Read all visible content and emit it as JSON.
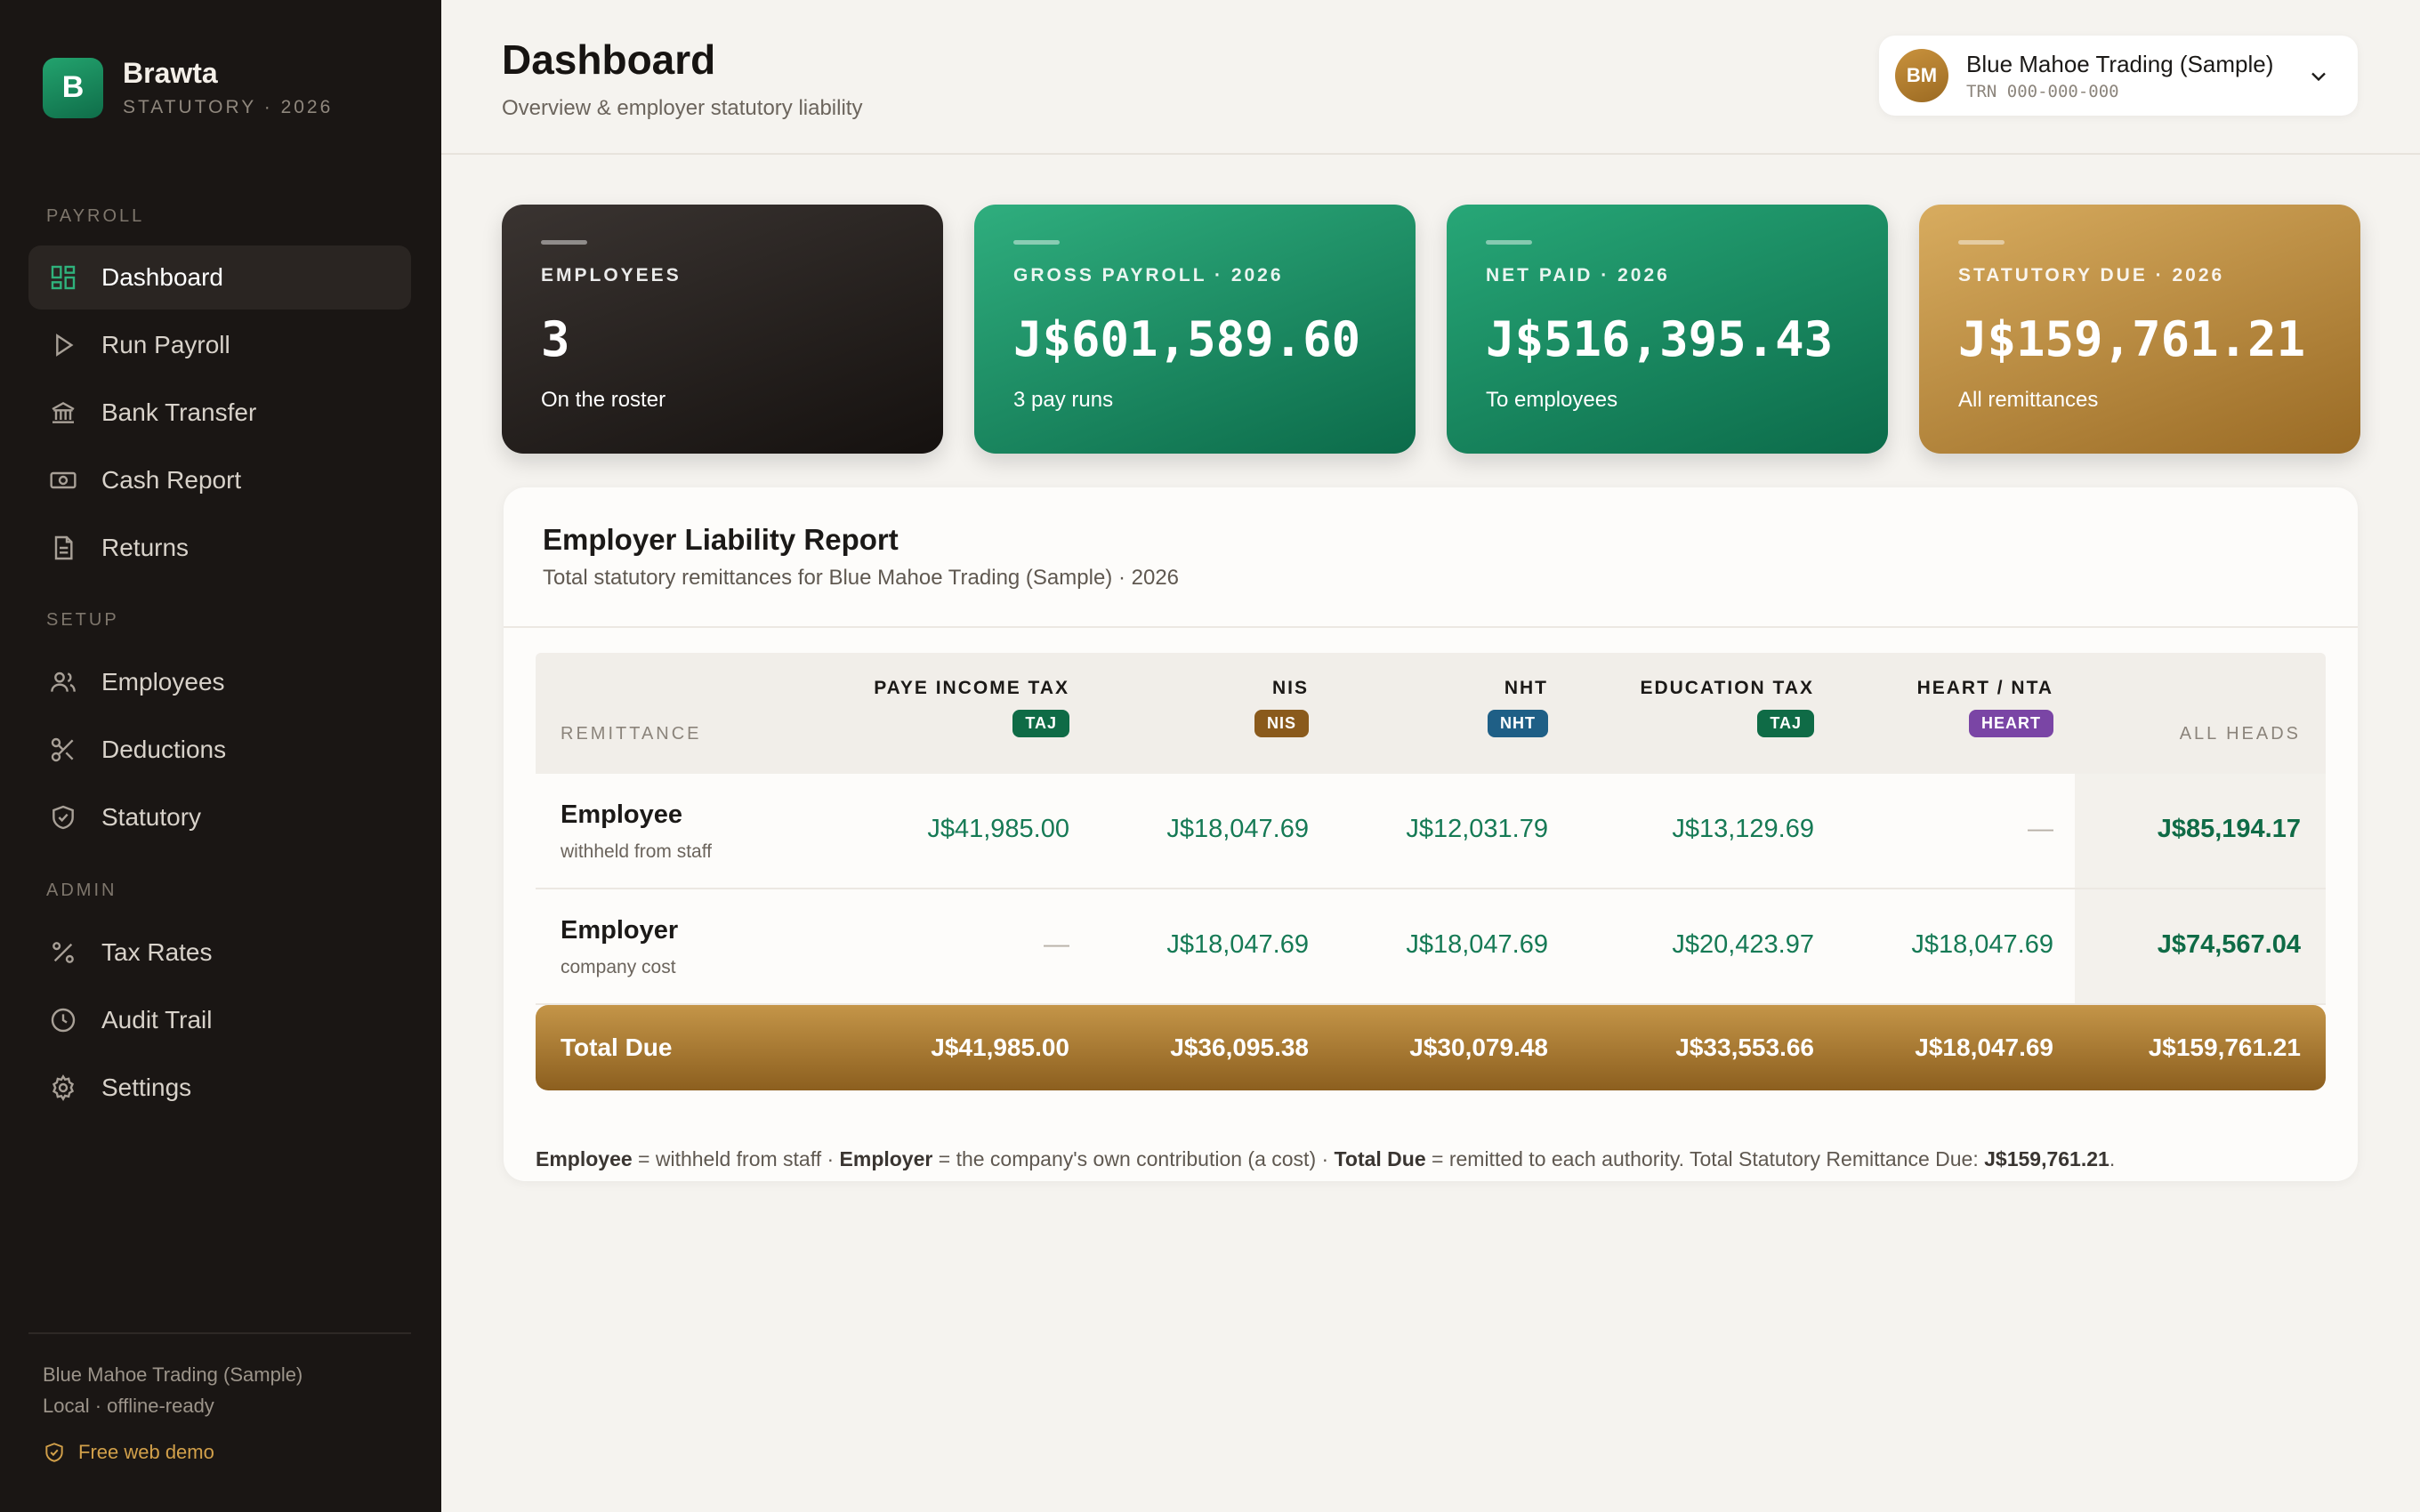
{
  "brand": {
    "logo_letter": "B",
    "name": "Brawta",
    "sub": "STATUTORY · 2026"
  },
  "nav": {
    "sections": {
      "payroll": "PAYROLL",
      "setup": "SETUP",
      "admin": "ADMIN"
    },
    "items": [
      {
        "label": "Dashboard",
        "icon": "grid-icon",
        "active": true
      },
      {
        "label": "Run Payroll",
        "icon": "play-icon"
      },
      {
        "label": "Bank Transfer",
        "icon": "bank-icon"
      },
      {
        "label": "Cash Report",
        "icon": "cash-icon"
      },
      {
        "label": "Returns",
        "icon": "document-icon"
      },
      {
        "label": "Employees",
        "icon": "users-icon"
      },
      {
        "label": "Deductions",
        "icon": "scissors-icon"
      },
      {
        "label": "Statutory",
        "icon": "shield-check-icon"
      },
      {
        "label": "Tax Rates",
        "icon": "percent-icon"
      },
      {
        "label": "Audit Trail",
        "icon": "clock-icon"
      },
      {
        "label": "Settings",
        "icon": "gear-icon"
      }
    ],
    "footer": {
      "org": "Blue Mahoe Trading (Sample)",
      "mode": "Local · offline-ready",
      "demo": "Free web demo"
    }
  },
  "header": {
    "title": "Dashboard",
    "subtitle": "Overview & employer statutory liability",
    "org": {
      "initials": "BM",
      "name": "Blue Mahoe Trading (Sample)",
      "trn": "TRN 000-000-000"
    }
  },
  "cards": [
    {
      "label": "EMPLOYEES",
      "value": "3",
      "sub": "On the roster"
    },
    {
      "label": "GROSS PAYROLL · 2026",
      "value": "J$601,589.60",
      "sub": "3 pay runs"
    },
    {
      "label": "NET PAID · 2026",
      "value": "J$516,395.43",
      "sub": "To employees"
    },
    {
      "label": "STATUTORY DUE · 2026",
      "value": "J$159,761.21",
      "sub": "All remittances"
    }
  ],
  "report": {
    "title": "Employer Liability Report",
    "subtitle": "Total statutory remittances for Blue Mahoe Trading (Sample) · 2026",
    "columns": {
      "remittance": "REMITTANCE",
      "heads": [
        {
          "title": "PAYE INCOME TAX",
          "badge": "TAJ",
          "color": "#0f6b46"
        },
        {
          "title": "NIS",
          "badge": "NIS",
          "color": "#8a5a1c"
        },
        {
          "title": "NHT",
          "badge": "NHT",
          "color": "#1f5f86"
        },
        {
          "title": "EDUCATION TAX",
          "badge": "TAJ",
          "color": "#0f6b46"
        },
        {
          "title": "HEART / NTA",
          "badge": "HEART",
          "color": "#7a45a5"
        }
      ],
      "all": "ALL HEADS"
    },
    "rows": [
      {
        "name": "Employee",
        "sub": "withheld from staff",
        "values": [
          "J$41,985.00",
          "J$18,047.69",
          "J$12,031.79",
          "J$13,129.69",
          "—"
        ],
        "total": "J$85,194.17"
      },
      {
        "name": "Employer",
        "sub": "company cost",
        "values": [
          "—",
          "J$18,047.69",
          "J$18,047.69",
          "J$20,423.97",
          "J$18,047.69"
        ],
        "total": "J$74,567.04"
      }
    ],
    "total_row": {
      "label": "Total Due",
      "values": [
        "J$41,985.00",
        "J$36,095.38",
        "J$30,079.48",
        "J$33,553.66",
        "J$18,047.69"
      ],
      "total": "J$159,761.21"
    },
    "footnote": {
      "employee_term": "Employee",
      "employee_def": " = withheld from staff · ",
      "employer_term": "Employer",
      "employer_def": " = the company's own contribution (a cost) · ",
      "total_term": "Total Due",
      "total_def": " = remitted to each authority. Total Statutory Remittance Due: ",
      "total_value": "J$159,761.21",
      "end": "."
    }
  }
}
